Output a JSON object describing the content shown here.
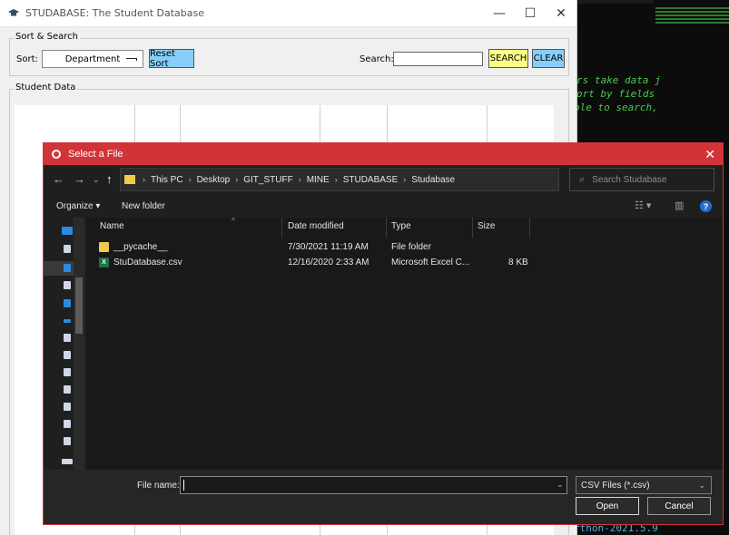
{
  "terminal": {
    "lines": [
      "rs take data j",
      "ort by fields",
      "ble to search,"
    ],
    "bottom_text": "rthon-2021.5.9"
  },
  "tk_window": {
    "title": "STUDABASE: The Student Database",
    "controls": {
      "minimize": "—",
      "maximize": "☐",
      "close": "✕"
    },
    "sort_search": {
      "frame_label": "Sort & Search",
      "sort_label": "Sort:",
      "sort_value": "Department",
      "reset_sort": "Reset Sort",
      "search_label": "Search:",
      "search_button": "SEARCH",
      "clear_button": "CLEAR"
    },
    "student_data_label": "Student Data"
  },
  "dialog": {
    "title": "Select a File",
    "close": "✕",
    "breadcrumb": [
      "This PC",
      "Desktop",
      "GIT_STUFF",
      "MINE",
      "STUDABASE",
      "Studabase"
    ],
    "search_placeholder": "Search Studabase",
    "toolbar": {
      "organize": "Organize ▾",
      "new_folder": "New folder"
    },
    "columns": {
      "name": "Name",
      "date": "Date modified",
      "type": "Type",
      "size": "Size"
    },
    "files": [
      {
        "name": "__pycache__",
        "date": "7/30/2021 11:19 AM",
        "type": "File folder",
        "size": ""
      },
      {
        "name": "StuDatabase.csv",
        "date": "12/16/2020 2:33 AM",
        "type": "Microsoft Excel C...",
        "size": "8 KB"
      }
    ],
    "file_name_label": "File name:",
    "file_name_value": "",
    "file_type": "CSV Files (*.csv)",
    "open_button": "Open",
    "cancel_button": "Cancel"
  },
  "colors": {
    "dialog_accent": "#d13438",
    "reset_sort_bg": "#87cefa",
    "search_bg": "#ffff88",
    "clear_bg": "#87cefa"
  }
}
